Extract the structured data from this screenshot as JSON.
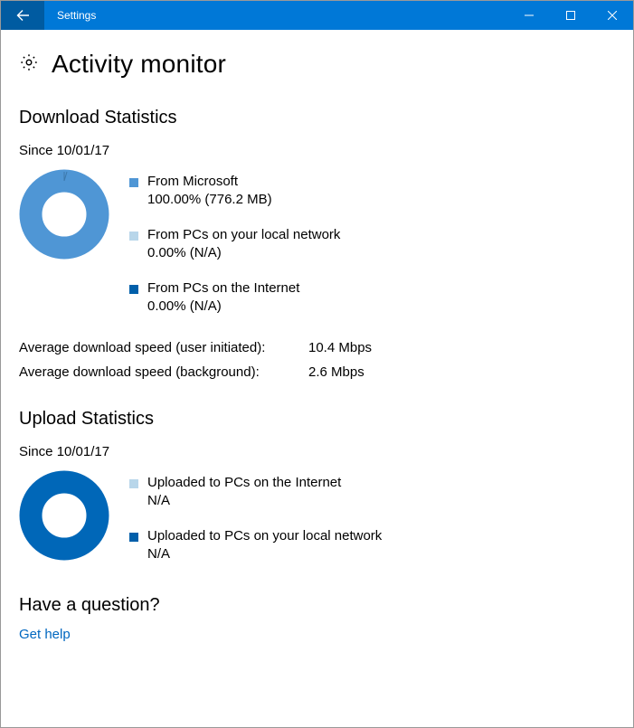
{
  "window": {
    "title": "Settings"
  },
  "page": {
    "title": "Activity monitor"
  },
  "download": {
    "section_title": "Download Statistics",
    "since": "Since 10/01/17",
    "legend": [
      {
        "label": "From Microsoft",
        "value": "100.00%  (776.2 MB)",
        "color": "#4f96d5"
      },
      {
        "label": "From PCs on your local network",
        "value": "0.00%  (N/A)",
        "color": "#b8d6ea"
      },
      {
        "label": "From PCs on the Internet",
        "value": "0.00%  (N/A)",
        "color": "#005faa"
      }
    ],
    "speed_user_label": "Average download speed (user initiated):",
    "speed_user_value": "10.4 Mbps",
    "speed_bg_label": "Average download speed (background):",
    "speed_bg_value": "2.6 Mbps"
  },
  "upload": {
    "section_title": "Upload Statistics",
    "since": "Since 10/01/17",
    "legend": [
      {
        "label": "Uploaded to PCs on the Internet",
        "value": "N/A",
        "color": "#b8d6ea"
      },
      {
        "label": "Uploaded to PCs on your local network",
        "value": "N/A",
        "color": "#005faa"
      }
    ]
  },
  "help": {
    "title": "Have a question?",
    "link": "Get help"
  },
  "chart_data": [
    {
      "type": "pie",
      "title": "Download Statistics",
      "categories": [
        "From Microsoft",
        "From PCs on your local network",
        "From PCs on the Internet"
      ],
      "values": [
        100.0,
        0.0,
        0.0
      ],
      "colors": [
        "#4f96d5",
        "#b8d6ea",
        "#005faa"
      ]
    },
    {
      "type": "pie",
      "title": "Upload Statistics",
      "categories": [
        "Uploaded to PCs on the Internet",
        "Uploaded to PCs on your local network"
      ],
      "values": [
        0,
        0
      ],
      "colors": [
        "#b8d6ea",
        "#005faa"
      ]
    }
  ]
}
